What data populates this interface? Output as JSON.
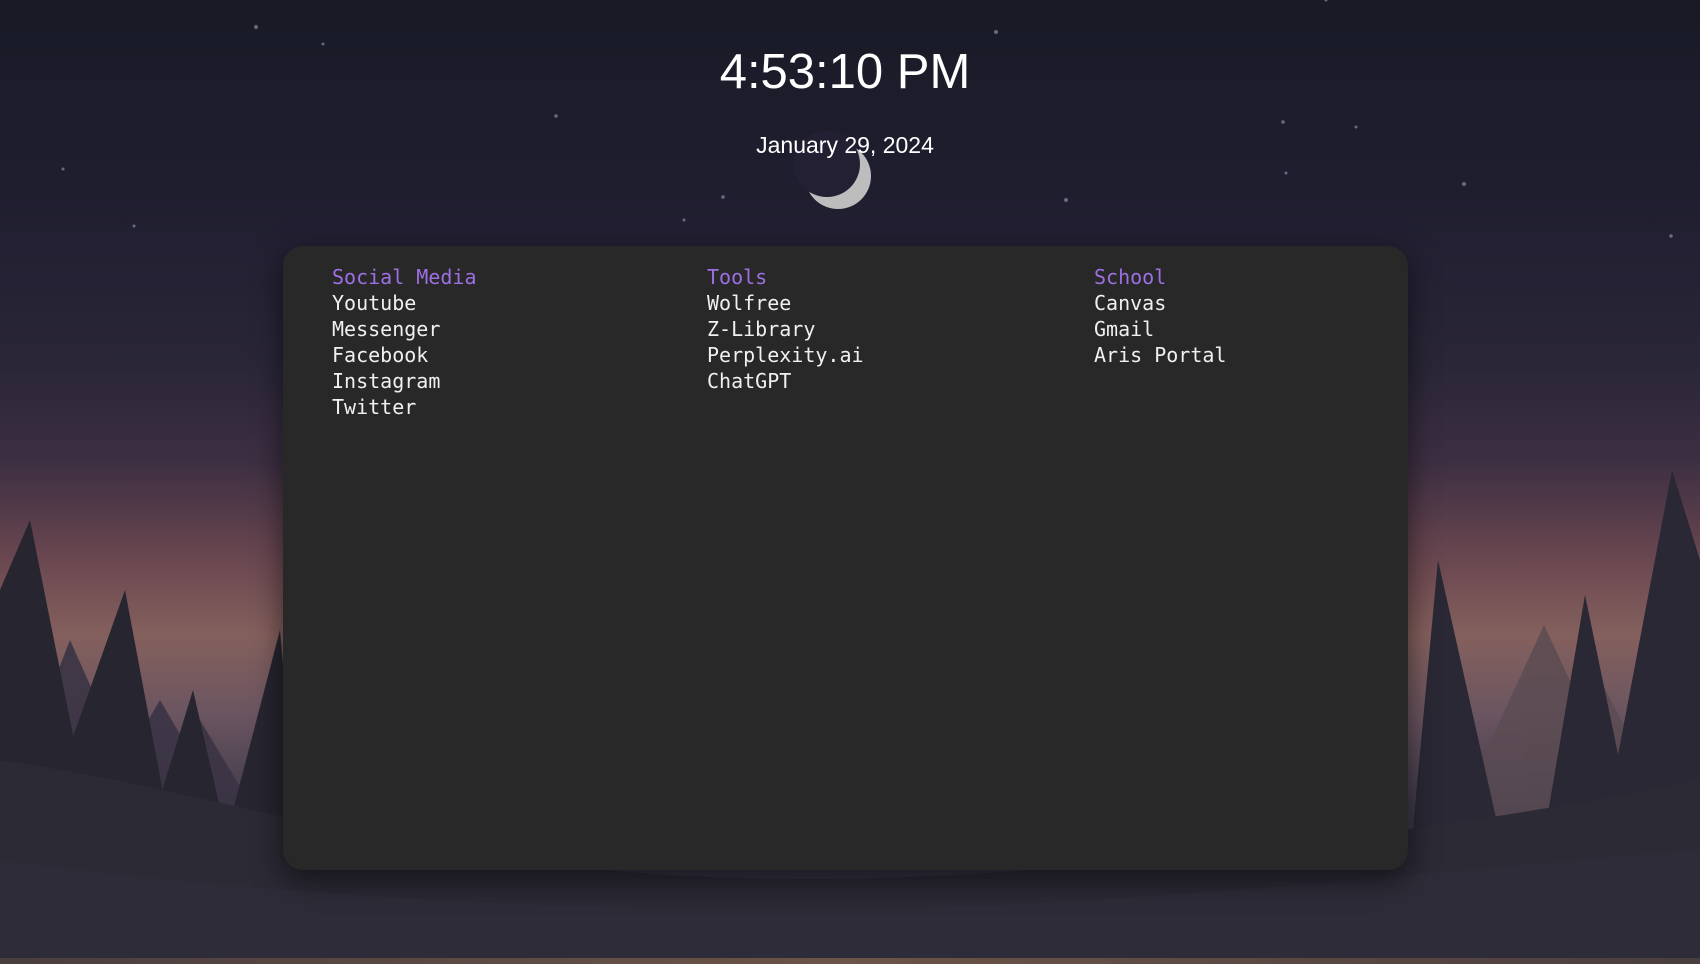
{
  "clock": {
    "time": "4:53:10 PM",
    "date": "January 29, 2024"
  },
  "colors": {
    "heading": "#9d6fe3",
    "link": "#f0f0f0",
    "panel": "#282828"
  },
  "scenery": {
    "moon_icon": "crescent-moon-icon"
  },
  "sections": [
    {
      "title": "Social Media",
      "links": [
        "Youtube",
        "Messenger",
        "Facebook",
        "Instagram",
        "Twitter"
      ]
    },
    {
      "title": "Tools",
      "links": [
        "Wolfree",
        "Z-Library",
        "Perplexity.ai",
        "ChatGPT"
      ]
    },
    {
      "title": "School",
      "links": [
        "Canvas",
        "Gmail",
        "Aris Portal"
      ]
    }
  ]
}
